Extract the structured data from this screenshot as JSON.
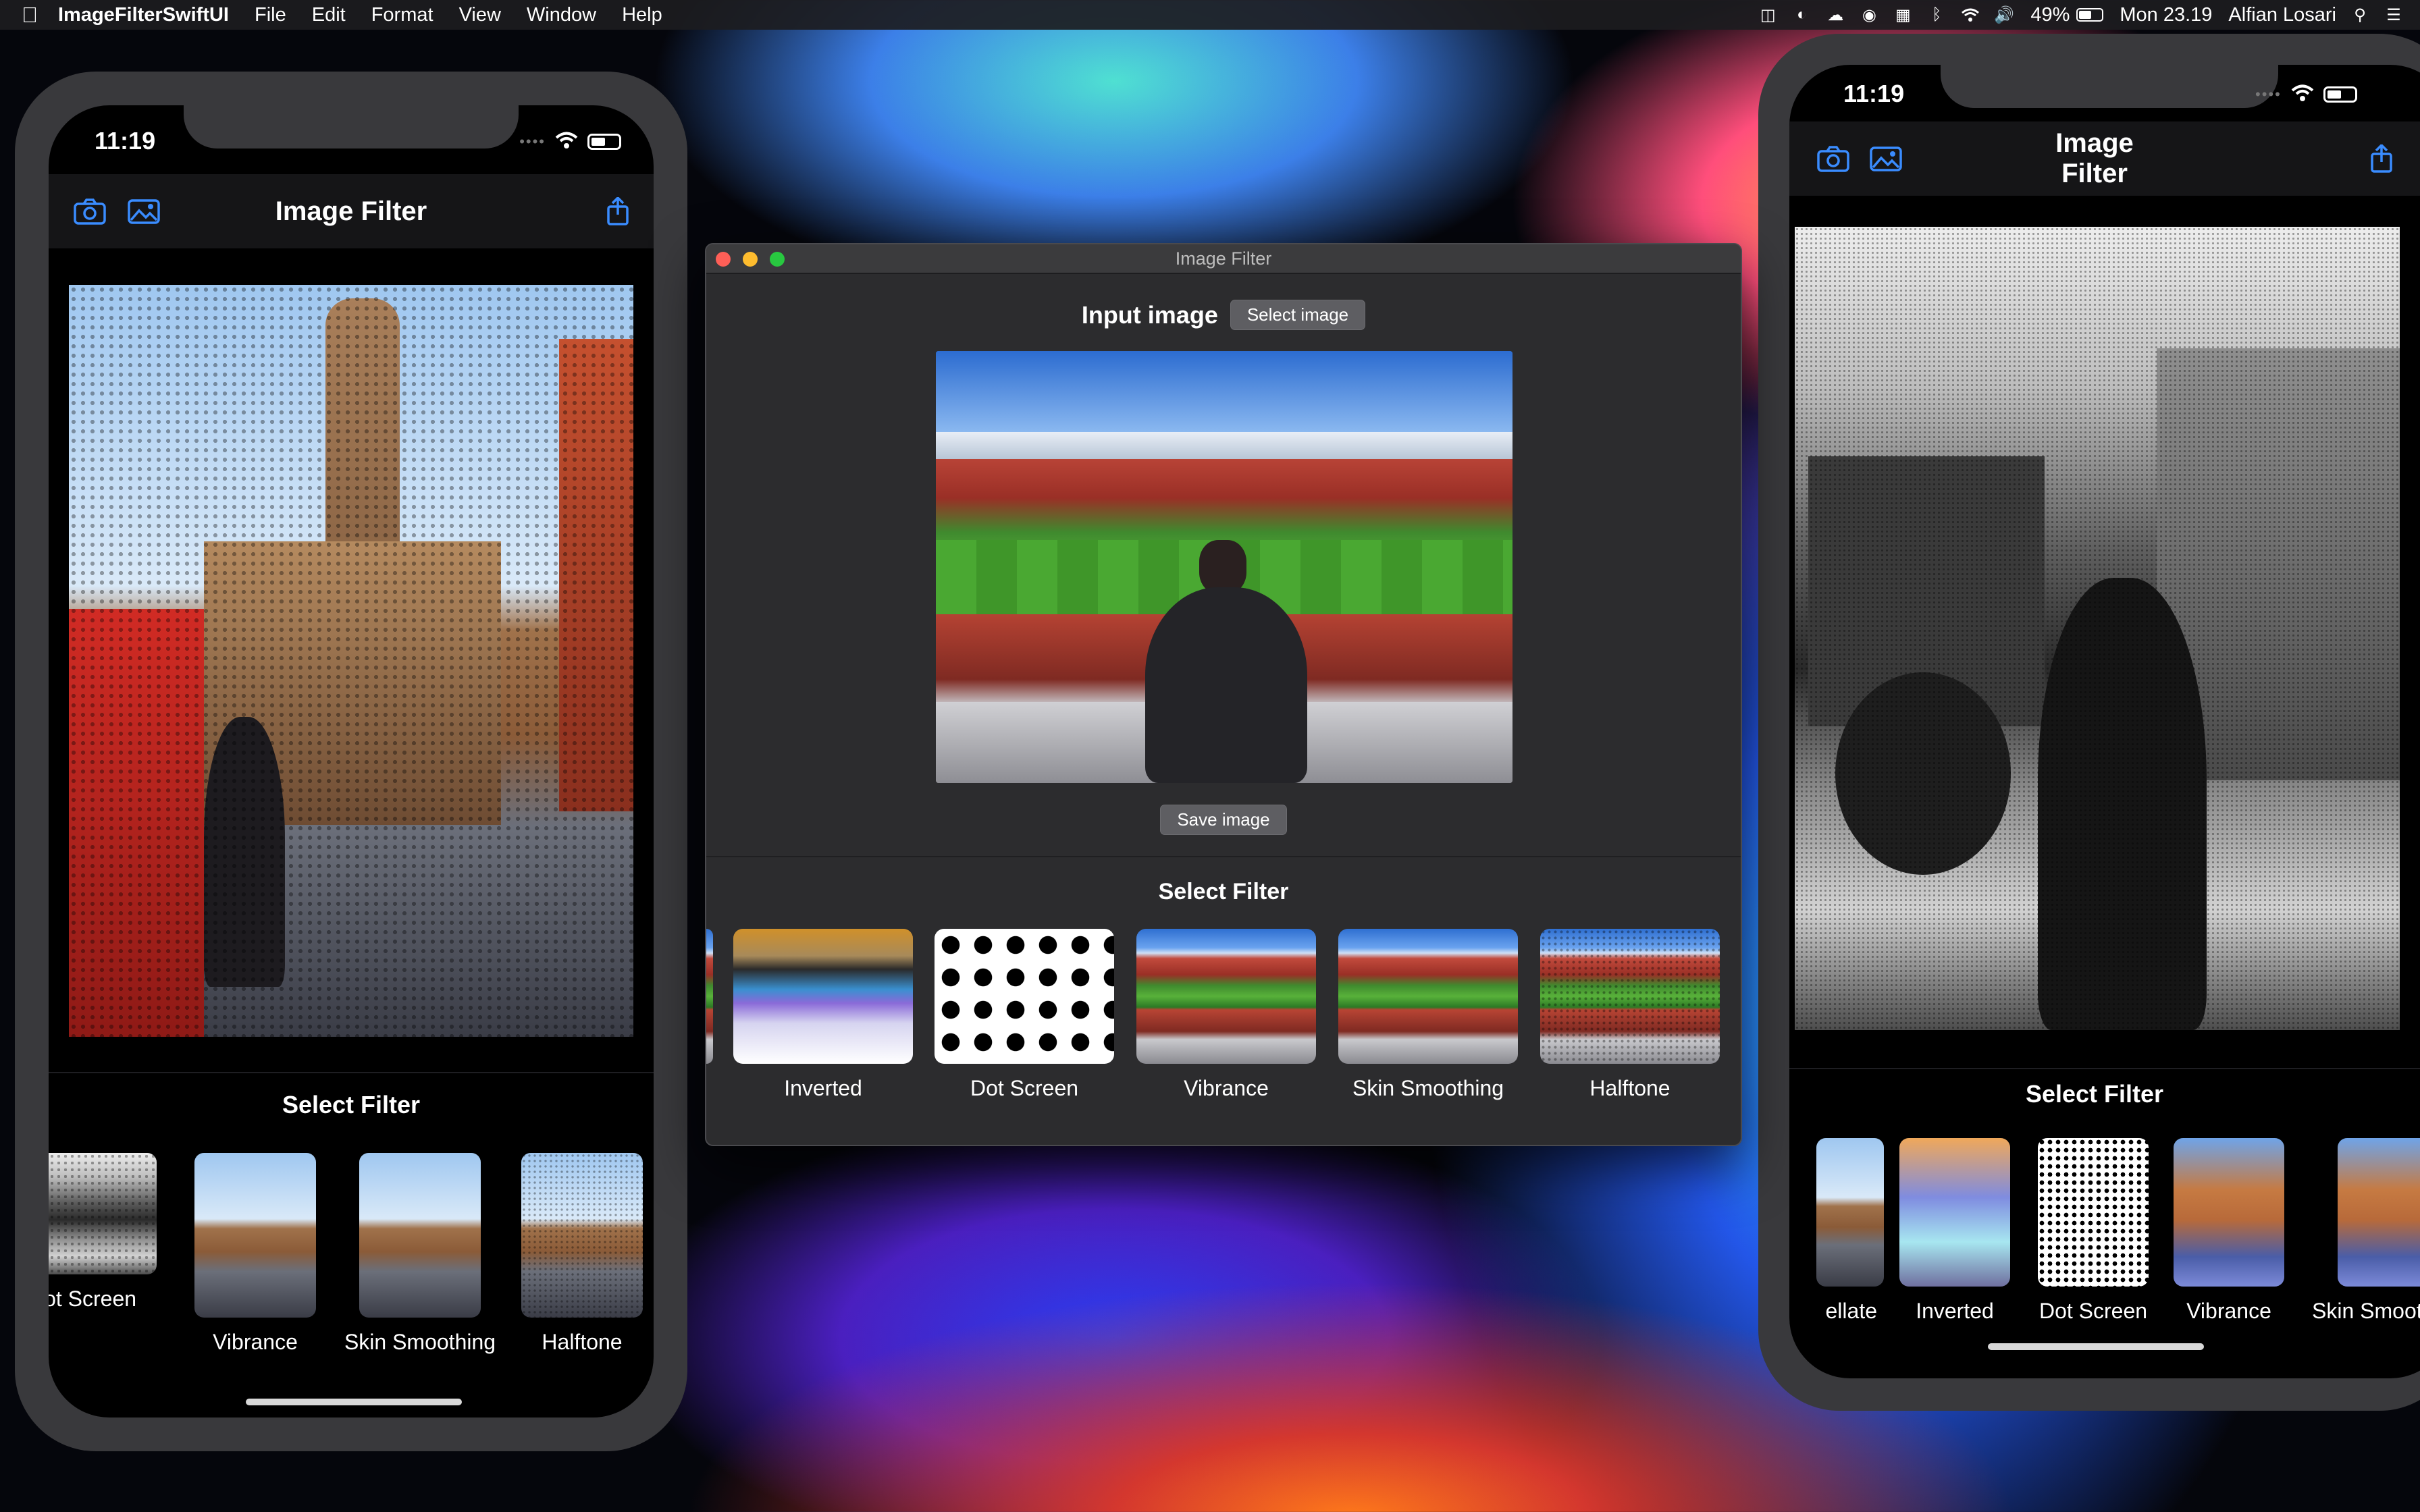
{
  "menubar": {
    "app_name": "ImageFilterSwiftUI",
    "items": [
      "File",
      "Edit",
      "Format",
      "View",
      "Window",
      "Help"
    ],
    "battery": "49%",
    "clock": "Mon 23.19",
    "user": "Alfian Losari",
    "status_icons": [
      "storage-icon",
      "cursor-icon",
      "cloud-icon",
      "ghost-icon",
      "grid-icon",
      "bluetooth-icon",
      "wifi-icon",
      "volume-icon",
      "battery-icon",
      "spotlight-icon",
      "control-center-icon"
    ]
  },
  "phone_left": {
    "time": "11:19",
    "nav_title": "Image Filter",
    "section_title": "Select Filter",
    "filters": [
      "Dot Screen",
      "Vibrance",
      "Skin Smoothing",
      "Halftone"
    ]
  },
  "window": {
    "title": "Image Filter",
    "input_label": "Input image",
    "select_button": "Select image",
    "save_button": "Save image",
    "section_title": "Select Filter",
    "filters": [
      "Inverted",
      "Dot Screen",
      "Vibrance",
      "Skin Smoothing",
      "Halftone"
    ]
  },
  "phone_right": {
    "time": "11:19",
    "nav_title": "Image Filter",
    "section_title": "Select Filter",
    "filters": [
      "ellate",
      "Inverted",
      "Dot Screen",
      "Vibrance",
      "Skin Smooth"
    ]
  }
}
